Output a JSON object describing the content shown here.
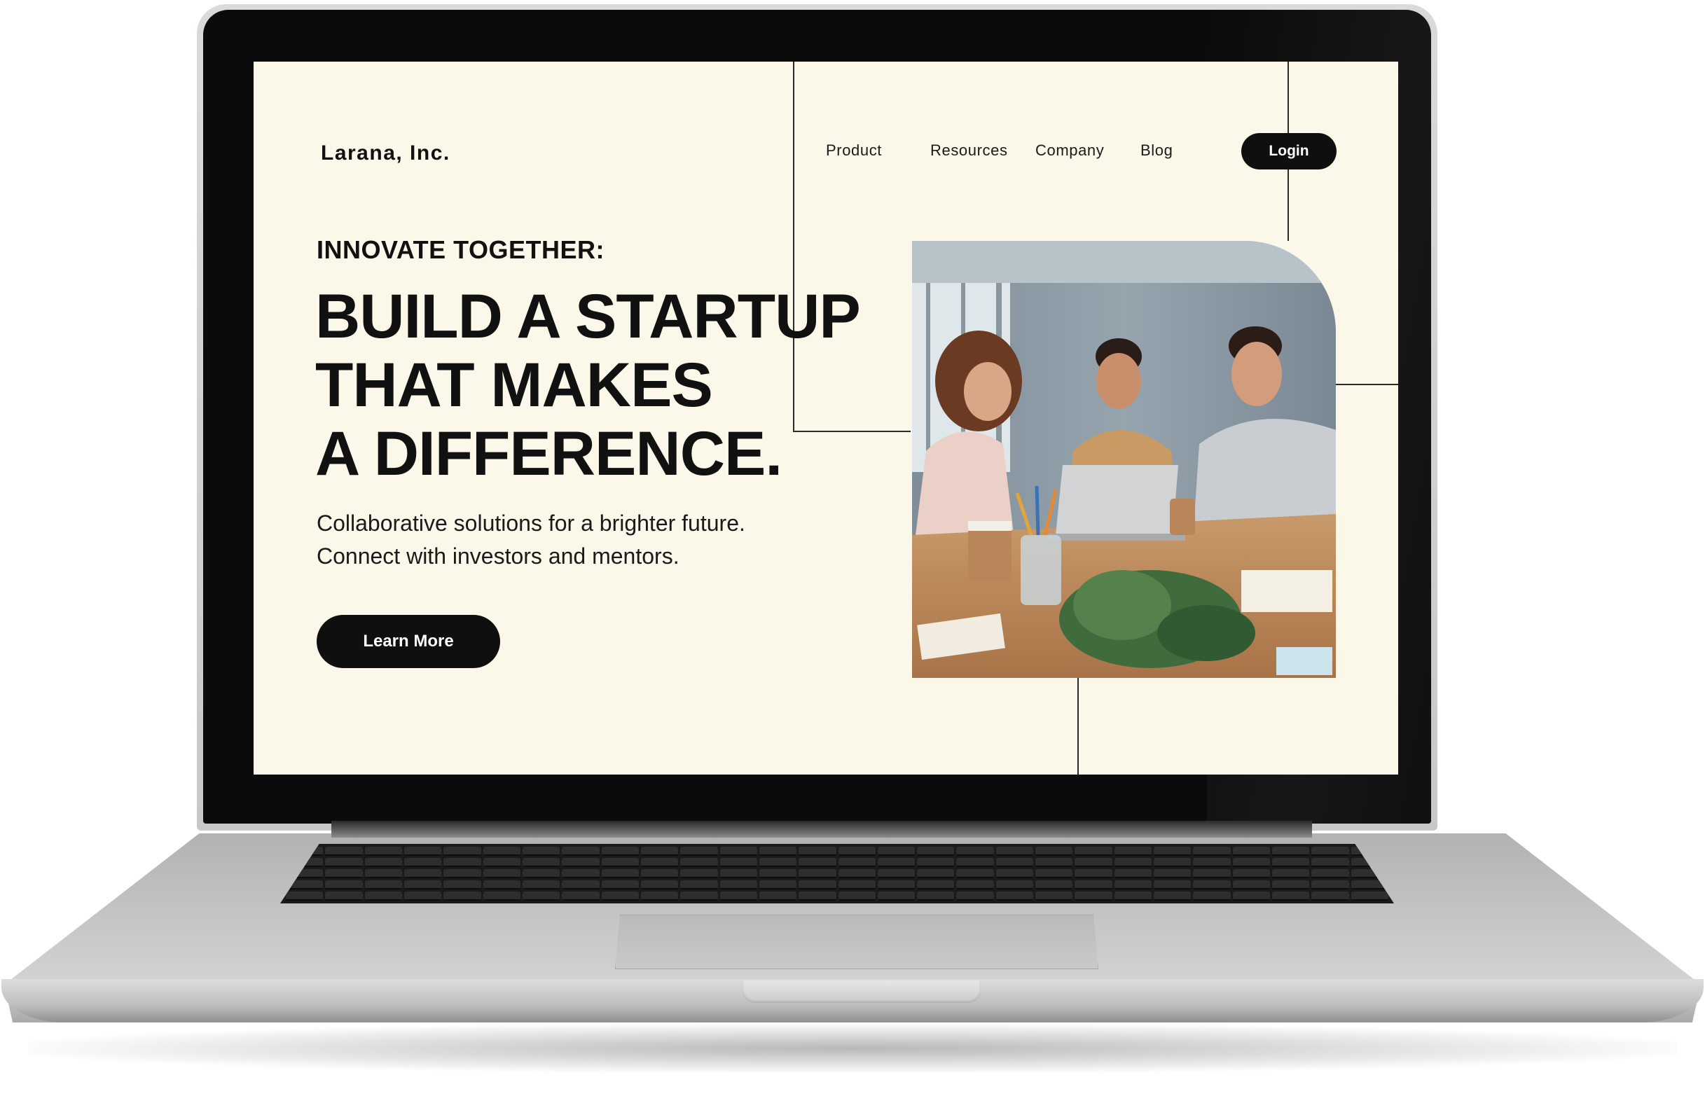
{
  "site": {
    "brand": "Larana, Inc.",
    "nav": {
      "product": "Product",
      "resources": "Resources",
      "company": "Company",
      "blog": "Blog",
      "login": "Login"
    },
    "hero": {
      "eyebrow": "INNOVATE TOGETHER:",
      "headline": [
        "BUILD A STARTUP",
        "THAT MAKES",
        "A DIFFERENCE."
      ],
      "subtext": [
        "Collaborative solutions for a brighter future.",
        "Connect with investors and mentors."
      ],
      "cta": "Learn More"
    }
  },
  "colors": {
    "page_background": "#fbf8ea",
    "button": "#0f0f10",
    "button_text": "#ffffff",
    "text": "#111111"
  }
}
